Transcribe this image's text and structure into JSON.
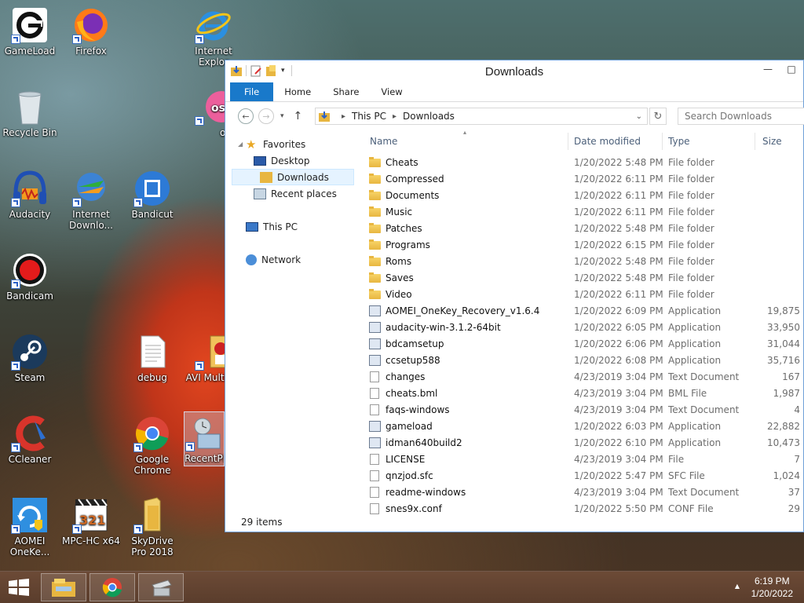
{
  "desktop": {
    "icons": [
      {
        "label": "GameLoad"
      },
      {
        "label": "Firefox"
      },
      {
        "label": "Internet Explor"
      },
      {
        "label": "Recycle Bin"
      },
      {
        "label": "osu!"
      },
      {
        "label": "Audacity"
      },
      {
        "label": "Internet Downlo..."
      },
      {
        "label": "Bandicut"
      },
      {
        "label": "Bandicam"
      },
      {
        "label": "Steam"
      },
      {
        "label": "debug"
      },
      {
        "label": "AVI Multime"
      },
      {
        "label": "CCleaner"
      },
      {
        "label": "Google Chrome"
      },
      {
        "label": "RecentPl"
      },
      {
        "label": "AOMEI OneKe..."
      },
      {
        "label": "MPC-HC x64"
      },
      {
        "label": "SkyDrive Pro 2018"
      }
    ]
  },
  "window": {
    "title": "Downloads",
    "ribbon_tabs": [
      "File",
      "Home",
      "Share",
      "View"
    ],
    "breadcrumb": [
      "This PC",
      "Downloads"
    ],
    "search_placeholder": "Search Downloads",
    "nav": {
      "favorites": "Favorites",
      "desktop": "Desktop",
      "downloads": "Downloads",
      "recent": "Recent places",
      "this_pc": "This PC",
      "network": "Network"
    },
    "columns": {
      "name": "Name",
      "date": "Date modified",
      "type": "Type",
      "size": "Size"
    },
    "files": [
      {
        "name": "Cheats",
        "date": "1/20/2022 5:48 PM",
        "type": "File folder",
        "size": "",
        "icon": "folder"
      },
      {
        "name": "Compressed",
        "date": "1/20/2022 6:11 PM",
        "type": "File folder",
        "size": "",
        "icon": "folder"
      },
      {
        "name": "Documents",
        "date": "1/20/2022 6:11 PM",
        "type": "File folder",
        "size": "",
        "icon": "folder"
      },
      {
        "name": "Music",
        "date": "1/20/2022 6:11 PM",
        "type": "File folder",
        "size": "",
        "icon": "folder"
      },
      {
        "name": "Patches",
        "date": "1/20/2022 5:48 PM",
        "type": "File folder",
        "size": "",
        "icon": "folder"
      },
      {
        "name": "Programs",
        "date": "1/20/2022 6:15 PM",
        "type": "File folder",
        "size": "",
        "icon": "folder"
      },
      {
        "name": "Roms",
        "date": "1/20/2022 5:48 PM",
        "type": "File folder",
        "size": "",
        "icon": "folder"
      },
      {
        "name": "Saves",
        "date": "1/20/2022 5:48 PM",
        "type": "File folder",
        "size": "",
        "icon": "folder"
      },
      {
        "name": "Video",
        "date": "1/20/2022 6:11 PM",
        "type": "File folder",
        "size": "",
        "icon": "folder"
      },
      {
        "name": "AOMEI_OneKey_Recovery_v1.6.4",
        "date": "1/20/2022 6:09 PM",
        "type": "Application",
        "size": "19,875",
        "icon": "app"
      },
      {
        "name": "audacity-win-3.1.2-64bit",
        "date": "1/20/2022 6:05 PM",
        "type": "Application",
        "size": "33,950",
        "icon": "app"
      },
      {
        "name": "bdcamsetup",
        "date": "1/20/2022 6:06 PM",
        "type": "Application",
        "size": "31,044",
        "icon": "app"
      },
      {
        "name": "ccsetup588",
        "date": "1/20/2022 6:08 PM",
        "type": "Application",
        "size": "35,716",
        "icon": "app"
      },
      {
        "name": "changes",
        "date": "4/23/2019 3:04 PM",
        "type": "Text Document",
        "size": "167",
        "icon": "doc"
      },
      {
        "name": "cheats.bml",
        "date": "4/23/2019 3:04 PM",
        "type": "BML File",
        "size": "1,987",
        "icon": "doc"
      },
      {
        "name": "faqs-windows",
        "date": "4/23/2019 3:04 PM",
        "type": "Text Document",
        "size": "4",
        "icon": "doc"
      },
      {
        "name": "gameload",
        "date": "1/20/2022 6:03 PM",
        "type": "Application",
        "size": "22,882",
        "icon": "app"
      },
      {
        "name": "idman640build2",
        "date": "1/20/2022 6:10 PM",
        "type": "Application",
        "size": "10,473",
        "icon": "app"
      },
      {
        "name": "LICENSE",
        "date": "4/23/2019 3:04 PM",
        "type": "File",
        "size": "7",
        "icon": "doc"
      },
      {
        "name": "qnzjod.sfc",
        "date": "1/20/2022 5:47 PM",
        "type": "SFC File",
        "size": "1,024",
        "icon": "doc"
      },
      {
        "name": "readme-windows",
        "date": "4/23/2019 3:04 PM",
        "type": "Text Document",
        "size": "37",
        "icon": "doc"
      },
      {
        "name": "snes9x.conf",
        "date": "1/20/2022 5:50 PM",
        "type": "CONF File",
        "size": "29",
        "icon": "doc"
      }
    ],
    "status": "29 items"
  },
  "taskbar": {
    "time": "6:19 PM",
    "date": "1/20/2022",
    "tray_arrow": "▲"
  },
  "colors": {
    "accent": "#1979ca",
    "selection": "#e5f3ff"
  }
}
